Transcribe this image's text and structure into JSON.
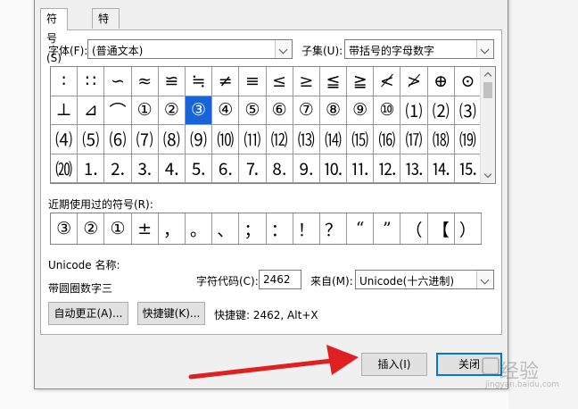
{
  "tabs": [
    "符号(S)",
    "特殊字符(P)"
  ],
  "font": {
    "label": "字体(F):",
    "value": "(普通文本)"
  },
  "subset": {
    "label": "子集(U):",
    "value": "带括号的字母数字"
  },
  "grid_rows": [
    [
      "∶",
      "∷",
      "∽",
      "≈",
      "≌",
      "≒",
      "≠",
      "≡",
      "≤",
      "≥",
      "≦",
      "≧",
      "≮",
      "≯",
      "⊕",
      "⊙"
    ],
    [
      "⊥",
      "⊿",
      "⌒",
      "①",
      "②",
      "③",
      "④",
      "⑤",
      "⑥",
      "⑦",
      "⑧",
      "⑨",
      "⑩",
      "⑴",
      "⑵",
      "⑶"
    ],
    [
      "⑷",
      "⑸",
      "⑹",
      "⑺",
      "⑻",
      "⑼",
      "⑽",
      "⑾",
      "⑿",
      "⒀",
      "⒁",
      "⒂",
      "⒃",
      "⒄",
      "⒅",
      "⒆"
    ],
    [
      "⒇",
      "⒈",
      "⒉",
      "⒊",
      "⒋",
      "⒌",
      "⒍",
      "⒎",
      "⒏",
      "⒐",
      "⒑",
      "⒒",
      "⒓",
      "⒔",
      "⒕",
      "⒖"
    ]
  ],
  "selected_symbol": "③",
  "recent": {
    "label": "近期使用过的符号(R):",
    "symbols": [
      "③",
      "②",
      "①",
      "±",
      "，",
      "。",
      "、",
      "；",
      "：",
      "！",
      "？",
      "“",
      "”",
      "（",
      "【",
      "）"
    ]
  },
  "unicode": {
    "name_label": "Unicode 名称:",
    "name_value": "带圆圈数字三"
  },
  "char_code": {
    "label": "字符代码(C):",
    "value": "2462"
  },
  "from": {
    "label": "来自(M):",
    "value": "Unicode(十六进制)"
  },
  "buttons": {
    "autocorrect": "自动更正(A)...",
    "shortcut": "快捷键(K)...",
    "shortcut_text": "快捷键: 2462, Alt+X",
    "insert": "插入(I)",
    "close": "关闭"
  },
  "watermark": {
    "main": "经验",
    "sub": "jingyan.baidu.com"
  },
  "colors": {
    "selection": "#1664d8",
    "arrow": "#e02020",
    "default_button_border": "#0078d7"
  }
}
